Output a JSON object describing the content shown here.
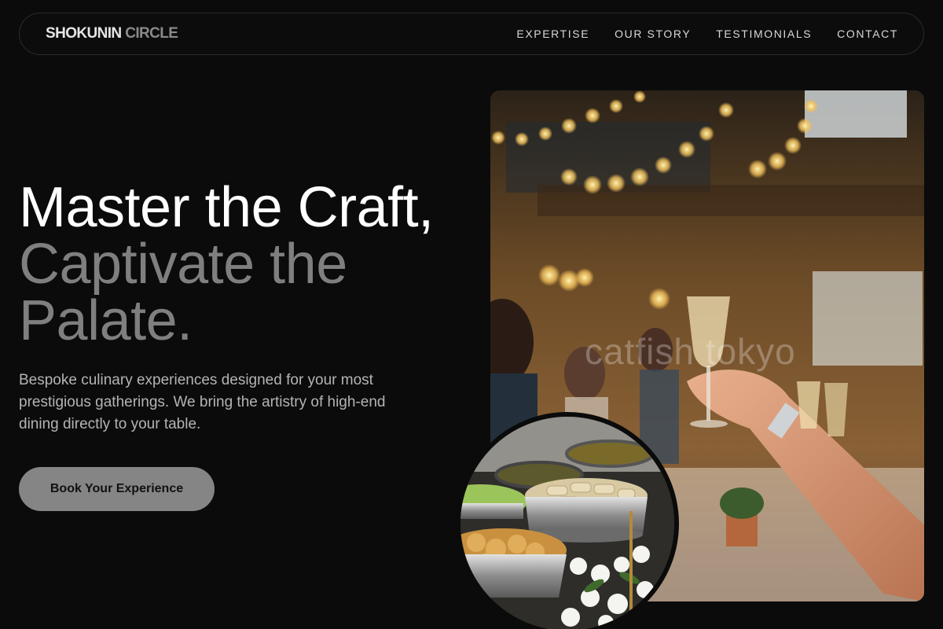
{
  "brand": {
    "part1": "SHOKUNIN",
    "part2": "CIRCLE"
  },
  "nav": {
    "links": [
      {
        "label": "EXPERTISE"
      },
      {
        "label": "OUR STORY"
      },
      {
        "label": "TESTIMONIALS"
      },
      {
        "label": "CONTACT"
      }
    ]
  },
  "hero": {
    "headline_line1": "Master the Craft,",
    "headline_line2": "Captivate the Palate.",
    "subtext": "Bespoke culinary experiences designed for your most prestigious gatherings. We bring the artistry of high-end dining directly to your table.",
    "cta_label": "Book Your Experience",
    "photo_watermark": "catfish tokyo"
  },
  "colors": {
    "background": "#0b0b0b",
    "headline_primary": "#ffffff",
    "headline_secondary": "#7f7f7f",
    "cta_background": "#858585"
  }
}
